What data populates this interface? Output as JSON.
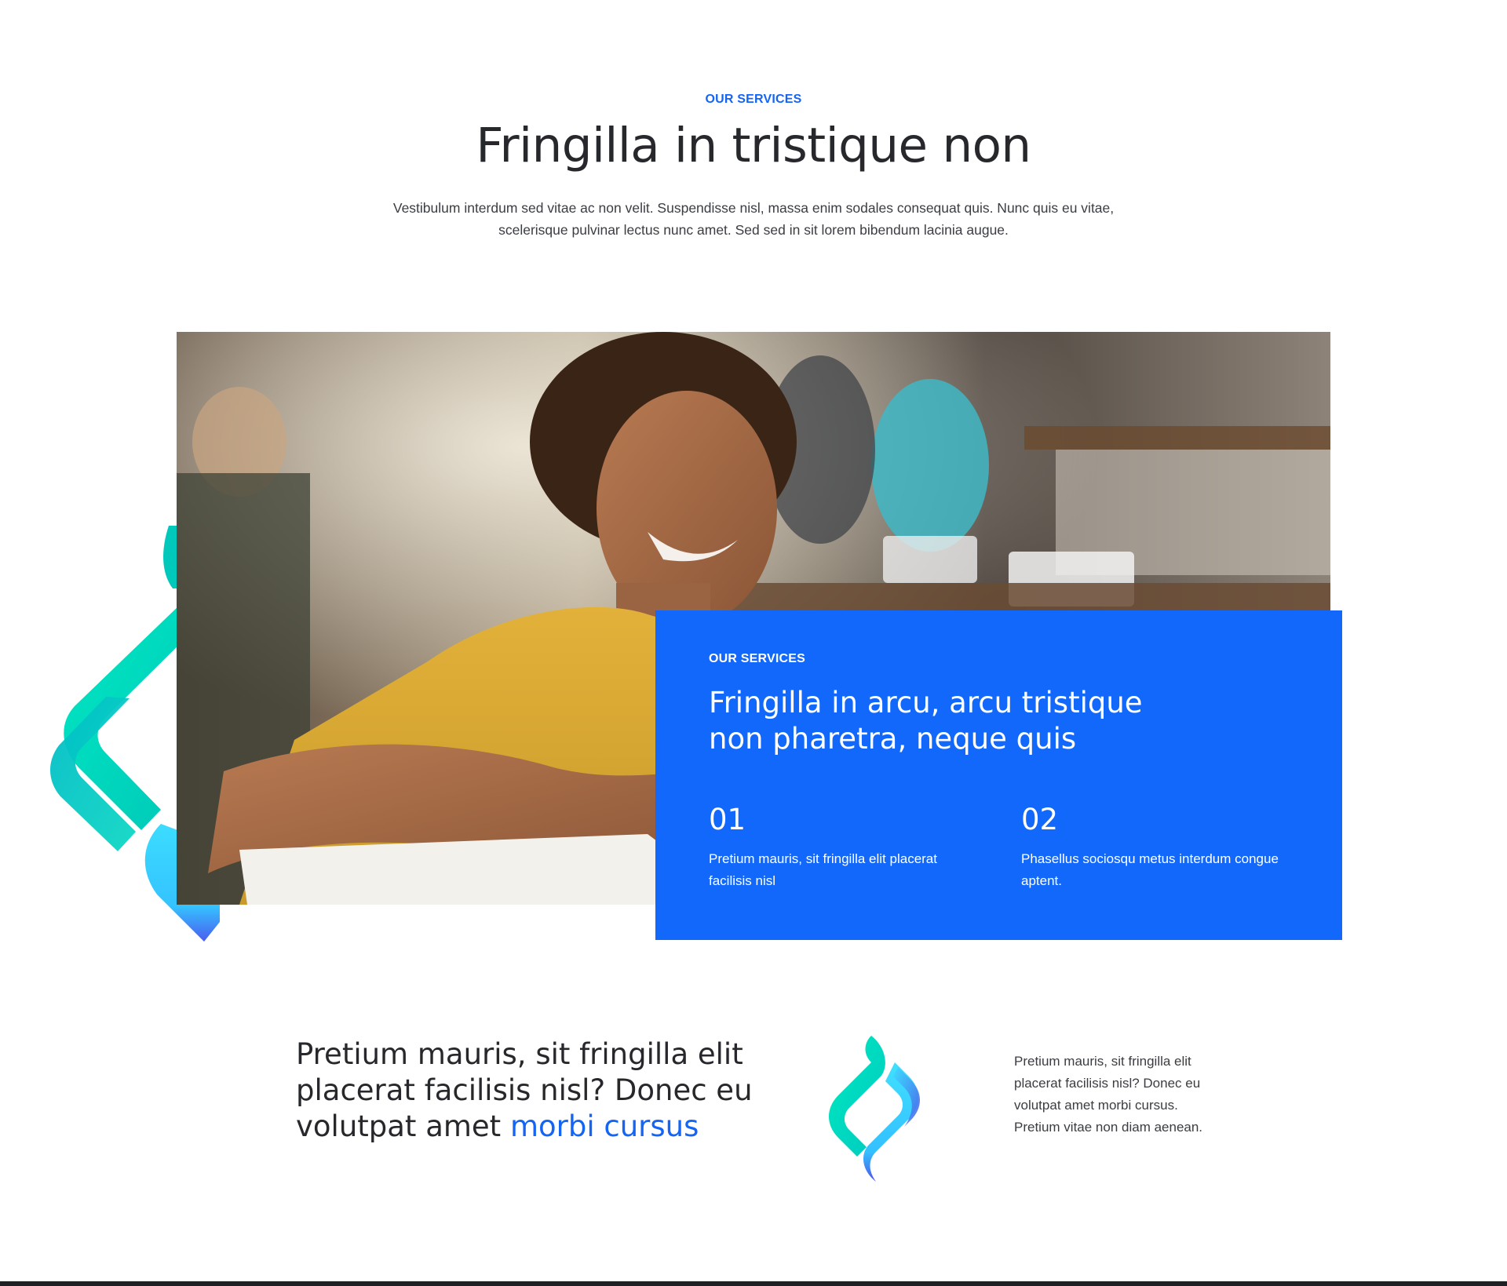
{
  "header": {
    "eyebrow": "OUR SERVICES",
    "title": "Fringilla in tristique non",
    "intro": "Vestibulum interdum sed vitae ac non velit. Suspendisse nisl, massa enim sodales consequat quis. Nunc quis eu vitae, scelerisque pulvinar lectus nunc amet. Sed sed in sit lorem bibendum lacinia augue."
  },
  "hero": {
    "photo_icon": "student-photo"
  },
  "service_card": {
    "eyebrow": "OUR SERVICES",
    "title": "Fringilla in arcu, arcu tristique non pharetra, neque quis",
    "features": [
      {
        "number": "01",
        "text": "Pretium mauris, sit fringilla elit placerat facilisis nisl"
      },
      {
        "number": "02",
        "text": "Phasellus sociosqu metus interdum congue aptent."
      }
    ]
  },
  "bottom": {
    "heading_main": "Pretium mauris, sit fringilla elit placerat facilisis nisl? Donec eu volutpat amet ",
    "heading_accent": "morbi cursus",
    "text": "Pretium mauris, sit fringilla elit placerat facilisis nisl? Donec eu volutpat amet morbi cursus. Pretium vitae non diam aenean."
  },
  "colors": {
    "accent_blue": "#1565f5",
    "card_blue": "#1268fb",
    "teal": "#00dfc0",
    "cyan": "#38d6ff",
    "indigo": "#4b5cf0",
    "text_dark": "#26282c"
  }
}
